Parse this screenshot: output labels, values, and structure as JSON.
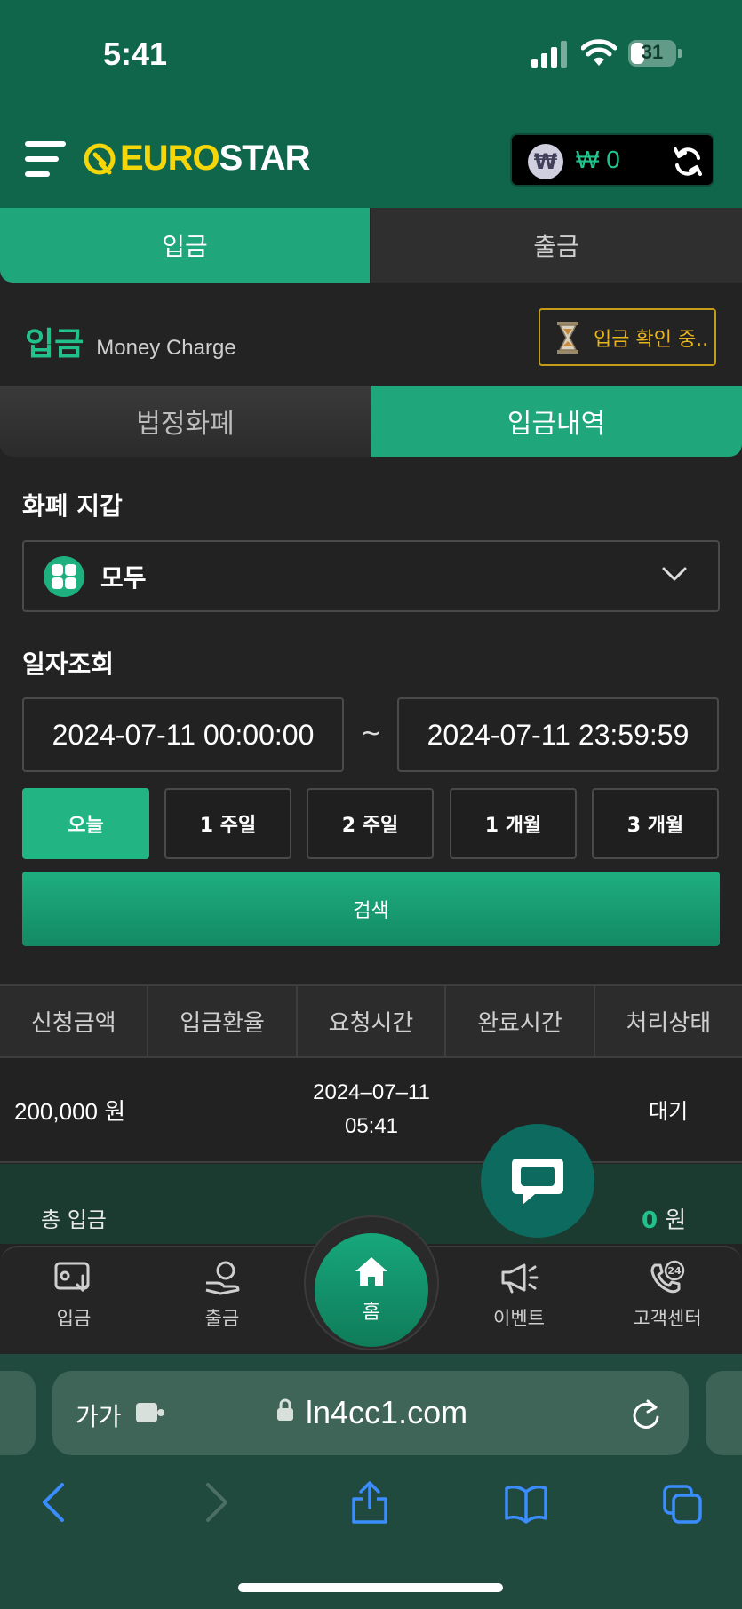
{
  "status_bar": {
    "time": "5:41",
    "battery": "31"
  },
  "header": {
    "logo_part1": "EURO",
    "logo_part2": "STAR",
    "wallet_currency_symbol": "₩",
    "wallet_amount": "₩ 0"
  },
  "main_tabs": [
    {
      "label": "입금",
      "active": true
    },
    {
      "label": "출금",
      "active": false
    }
  ],
  "section": {
    "title": "입금",
    "subtitle": "Money Charge",
    "pending_label": "입금 확인 중.."
  },
  "sub_tabs": [
    {
      "label": "법정화폐",
      "active": false
    },
    {
      "label": "입금내역",
      "active": true
    }
  ],
  "filters": {
    "wallet_label": "화폐 지갑",
    "wallet_value": "모두",
    "date_label": "일자조회",
    "date_from": "2024-07-11 00:00:00",
    "date_separator": "~",
    "date_to": "2024-07-11 23:59:59",
    "ranges": [
      "오늘",
      "1 주일",
      "2 주일",
      "1 개월",
      "3 개월"
    ],
    "active_range": "오늘",
    "search_label": "검색"
  },
  "table": {
    "columns": [
      "신청금액",
      "입금환율",
      "요청시간",
      "완료시간",
      "처리상태"
    ],
    "rows": [
      {
        "amount": "200,000 원",
        "rate": "",
        "request_date": "2024–07–11",
        "request_time": "05:41",
        "complete_time": "",
        "status": "대기"
      }
    ]
  },
  "total": {
    "label": "총 입금",
    "value": "0",
    "unit": "원"
  },
  "bottom_nav": [
    {
      "label": "입금",
      "icon": "wallet-download-icon"
    },
    {
      "label": "출금",
      "icon": "hand-coin-icon"
    },
    {
      "label": "홈",
      "icon": "home-icon"
    },
    {
      "label": "이벤트",
      "icon": "megaphone-icon"
    },
    {
      "label": "고객센터",
      "icon": "support-24-icon"
    }
  ],
  "browser": {
    "text_size_label": "가가",
    "url": "ln4cc1.com"
  },
  "colors": {
    "accent": "#1fa67a",
    "header_bg": "#10664b",
    "logo_yellow": "#f4d60a",
    "pending": "#e8b51c",
    "page_bg": "#232323"
  }
}
